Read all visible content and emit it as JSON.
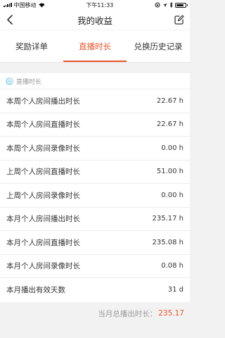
{
  "status_bar": {
    "carrier": "中国移动",
    "time": "下午11:33"
  },
  "nav": {
    "title": "我的收益"
  },
  "tabs": [
    {
      "label": "奖励详单",
      "active": false
    },
    {
      "label": "直播时长",
      "active": true
    },
    {
      "label": "兑换历史记录",
      "active": false
    }
  ],
  "section": {
    "title": "直播时长"
  },
  "rows": [
    {
      "label": "本周个人房间播出时长",
      "value": "22.67 h"
    },
    {
      "label": "本周个人房间直播时长",
      "value": "22.67 h"
    },
    {
      "label": "本周个人房间录像时长",
      "value": "0.00 h"
    },
    {
      "label": "上周个人房间直播时长",
      "value": "51.00 h"
    },
    {
      "label": "上周个人房间录像时长",
      "value": "0.00 h"
    },
    {
      "label": "本月个人房间播出时长",
      "value": "235.17 h"
    },
    {
      "label": "本月个人房间直播时长",
      "value": "235.08 h"
    },
    {
      "label": "本月个人房间录像时长",
      "value": "0.08 h"
    },
    {
      "label": "本月播出有效天数",
      "value": "31 d"
    }
  ],
  "total": {
    "label": "当月总播出时长：",
    "value": "235.17"
  },
  "colors": {
    "accent": "#e8542c",
    "muted": "#999999",
    "section_icon": "#aedcf0"
  }
}
